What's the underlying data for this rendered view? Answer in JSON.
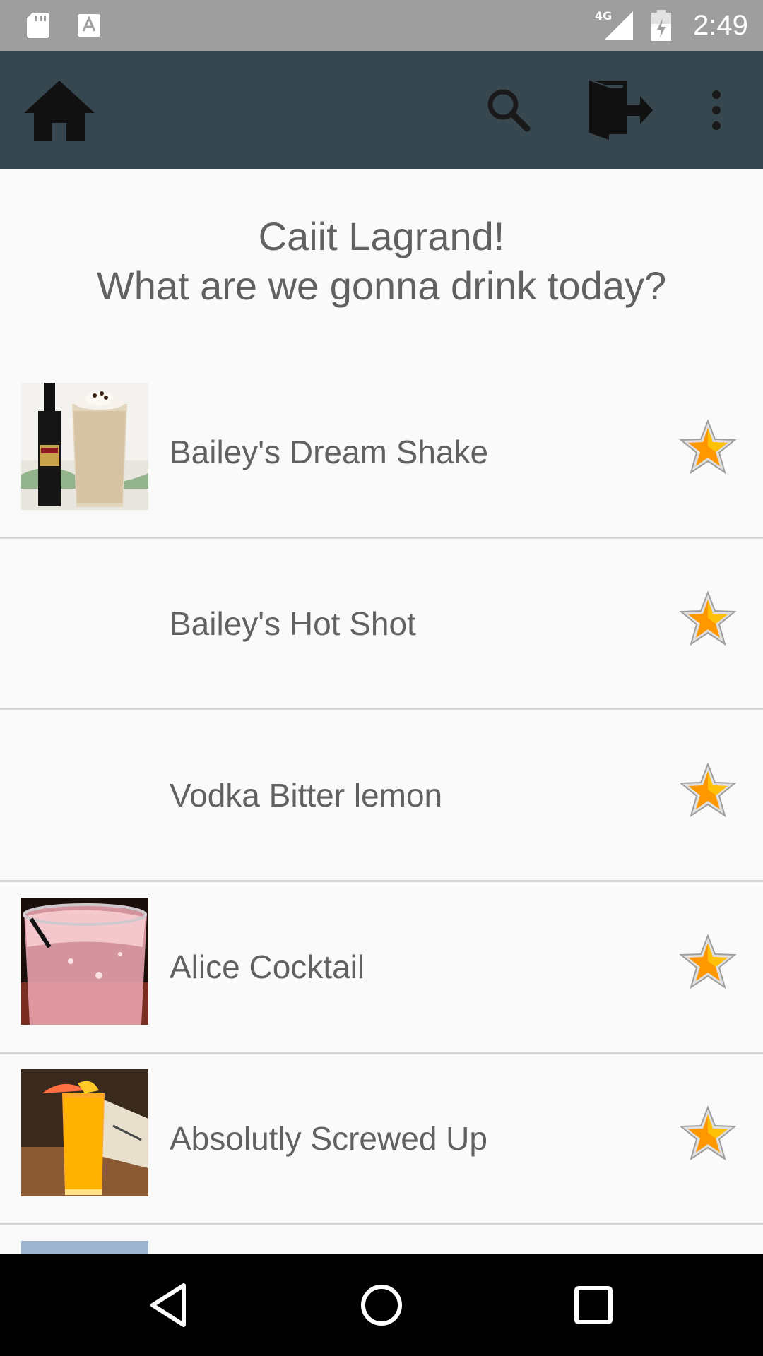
{
  "status_bar": {
    "network": "4G",
    "time": "2:49",
    "icons": [
      "sd-card-icon",
      "font-a-icon",
      "signal-icon",
      "battery-charging-icon"
    ]
  },
  "app_bar": {
    "icons": [
      "home-icon",
      "search-icon",
      "logout-icon",
      "more-vert-icon"
    ],
    "background": "#37474f"
  },
  "greeting": {
    "line1": "Caiit Lagrand!",
    "line2": "What are we gonna drink today?"
  },
  "drinks": [
    {
      "name": "Bailey's Dream Shake",
      "has_image": true,
      "image": "baileys-shake-thumbnail"
    },
    {
      "name": "Bailey's Hot Shot",
      "has_image": false
    },
    {
      "name": "Vodka Bitter lemon",
      "has_image": false
    },
    {
      "name": "Alice Cocktail",
      "has_image": true,
      "image": "pink-cocktail-thumbnail"
    },
    {
      "name": "Absolutly Screwed Up",
      "has_image": true,
      "image": "orange-drink-thumbnail"
    }
  ],
  "colors": {
    "status_bar": "#9e9e9e",
    "app_bar": "#37474f",
    "text": "#616161",
    "star": "#ff9800",
    "divider": "#d6d6d6"
  },
  "nav_bar": {
    "icons": [
      "back-icon",
      "home-circle-icon",
      "recents-icon"
    ]
  }
}
